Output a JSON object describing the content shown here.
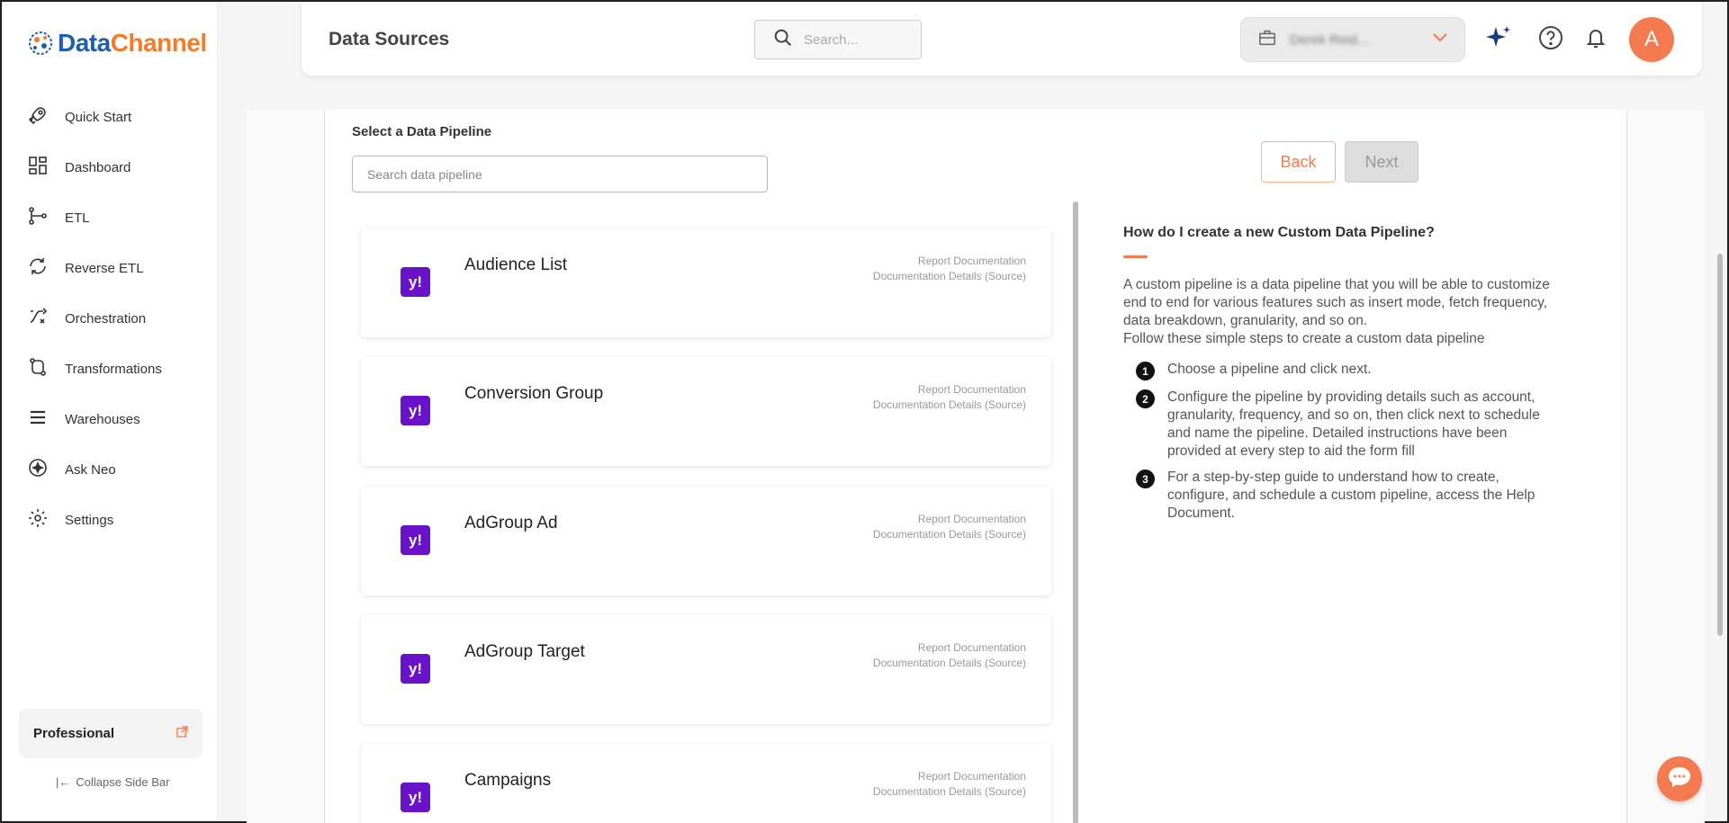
{
  "brand": {
    "name_part1": "Data",
    "name_part2": "Channel"
  },
  "sidebar": {
    "items": [
      {
        "label": "Quick Start",
        "icon": "rocket-icon"
      },
      {
        "label": "Dashboard",
        "icon": "dashboard-icon"
      },
      {
        "label": "ETL",
        "icon": "etl-icon"
      },
      {
        "label": "Reverse ETL",
        "icon": "reverse-etl-icon"
      },
      {
        "label": "Orchestration",
        "icon": "orchestration-icon"
      },
      {
        "label": "Transformations",
        "icon": "transformations-icon"
      },
      {
        "label": "Warehouses",
        "icon": "warehouses-icon"
      },
      {
        "label": "Ask Neo",
        "icon": "sparkle-icon"
      },
      {
        "label": "Settings",
        "icon": "gear-icon"
      }
    ],
    "plan": "Professional",
    "collapse_label": "Collapse Side Bar"
  },
  "header": {
    "title": "Data Sources",
    "search_placeholder": "Search...",
    "account_name": "Derek Reid..."
  },
  "main": {
    "section_label": "Select a Data Pipeline",
    "pipeline_search_placeholder": "Search data pipeline",
    "back_label": "Back",
    "next_label": "Next",
    "pipelines": [
      {
        "title": "Audience List",
        "link1": "Report Documentation",
        "link2": "Documentation Details (Source)"
      },
      {
        "title": "Conversion Group",
        "link1": "Report Documentation",
        "link2": "Documentation Details (Source)"
      },
      {
        "title": "AdGroup Ad",
        "link1": "Report Documentation",
        "link2": "Documentation Details (Source)"
      },
      {
        "title": "AdGroup Target",
        "link1": "Report Documentation",
        "link2": "Documentation Details (Source)"
      },
      {
        "title": "Campaigns",
        "link1": "Report Documentation",
        "link2": "Documentation Details (Source)"
      }
    ],
    "card_logo_text": "y!"
  },
  "help": {
    "title": "How do I create a new Custom Data Pipeline?",
    "para1": "A custom pipeline is a data pipeline that you will be able to customize end to end for various features such as insert mode, fetch frequency, data breakdown, granularity, and so on.",
    "para2": "Follow these simple steps to create a custom data pipeline",
    "steps": [
      {
        "num": "1",
        "text": "Choose a pipeline and click next."
      },
      {
        "num": "2",
        "text": "Configure the pipeline by providing details such as account, granularity, frequency, and so on, then click next to schedule and name the pipeline. Detailed instructions have been provided at every step to aid the form fill"
      },
      {
        "num": "3",
        "text": "For a step-by-step guide to understand how to create, configure, and schedule a custom pipeline, access the Help Document."
      }
    ]
  },
  "user": {
    "avatar_initial": "A"
  },
  "colors": {
    "accent": "#f47b50",
    "brand_blue": "#1d5fae",
    "yahoo_purple": "#6a12c9"
  }
}
